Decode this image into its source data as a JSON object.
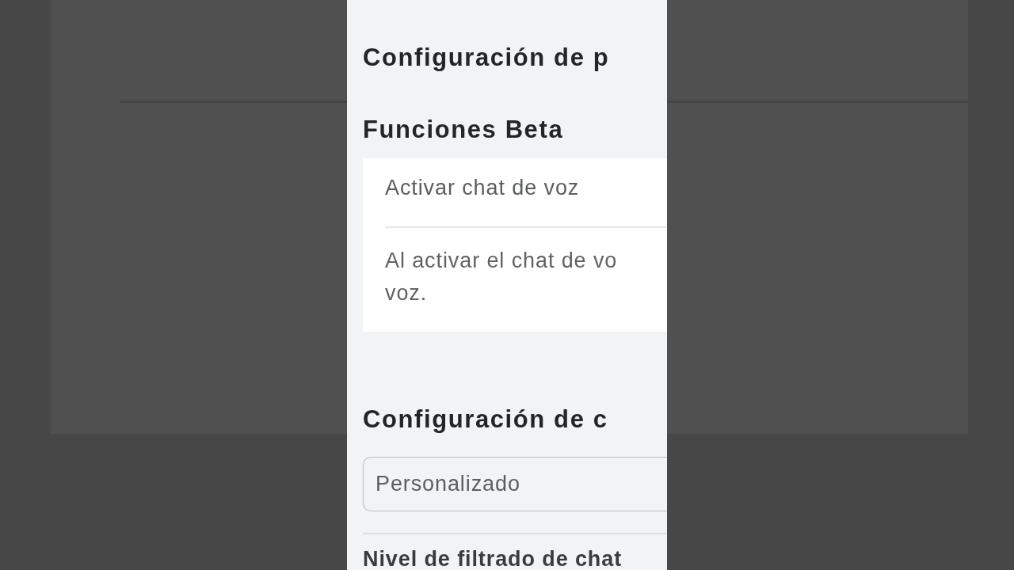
{
  "page_title": "Configuración de p",
  "beta_section": {
    "title": "Funciones Beta",
    "setting": {
      "label": "Activar chat de voz",
      "description_lines": [
        "Al activar el chat de vo",
        "voz."
      ]
    }
  },
  "chat_section": {
    "title": "Configuración de c",
    "dropdown": {
      "value": "Personalizado"
    },
    "next_label": "Nivel de filtrado de chat"
  }
}
